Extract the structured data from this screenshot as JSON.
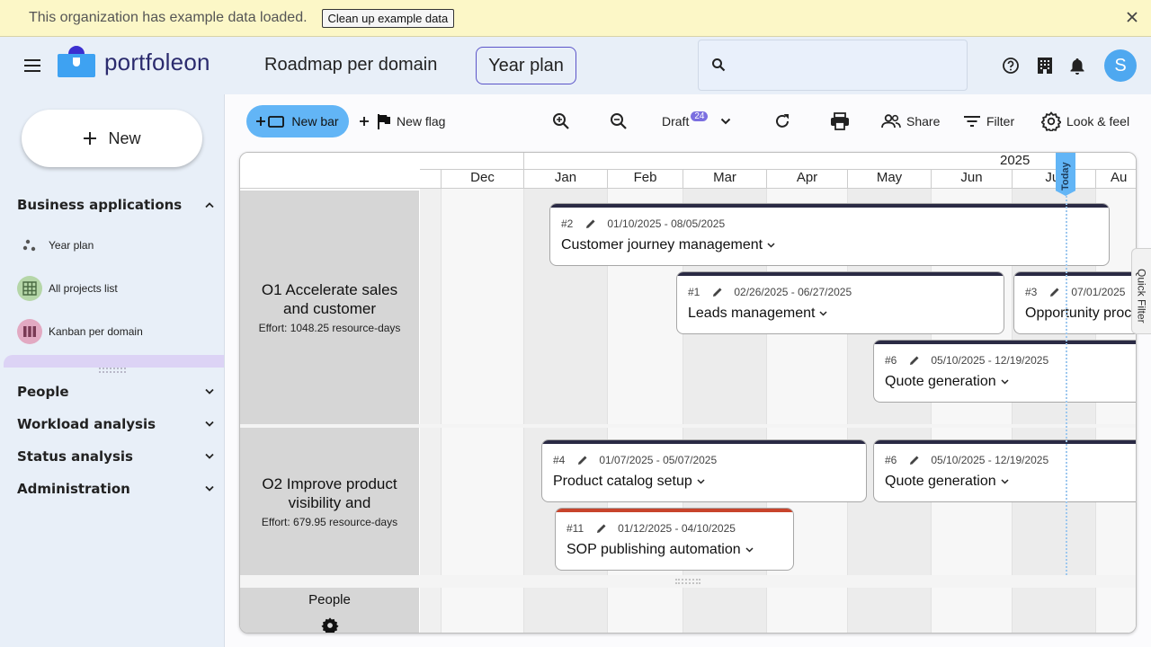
{
  "banner": {
    "text": "This organization has example data loaded.",
    "button_label": "Clean up example data"
  },
  "header": {
    "logo_text": "portfoleon",
    "page_title": "Roadmap per domain",
    "view_chip": "Year plan",
    "search_placeholder": "",
    "avatar_letter": "S"
  },
  "sidebar": {
    "new_label": "New",
    "sections": [
      {
        "label": "Business applications",
        "expanded": true
      },
      {
        "label": "People",
        "expanded": false
      },
      {
        "label": "Workload analysis",
        "expanded": false
      },
      {
        "label": "Status analysis",
        "expanded": false
      },
      {
        "label": "Administration",
        "expanded": false
      }
    ],
    "items": [
      {
        "label": "Year plan",
        "icon": "scatter-icon"
      },
      {
        "label": "All projects list",
        "icon": "grid-icon"
      },
      {
        "label": "Kanban per domain",
        "icon": "kanban-icon"
      }
    ]
  },
  "toolbar": {
    "new_bar": "New bar",
    "new_flag": "New flag",
    "draft_label": "Draft",
    "draft_count": "24",
    "share": "Share",
    "filter": "Filter",
    "look_feel": "Look & feel"
  },
  "timeline": {
    "year": "2025",
    "months": [
      "Dec",
      "Jan",
      "Feb",
      "Mar",
      "Apr",
      "May",
      "Jun",
      "Jul",
      "Au"
    ],
    "today_label": "Today"
  },
  "lanes": [
    {
      "title": "O1 Accelerate sales and customer",
      "effort": "Effort: 1048.25  resource-days"
    },
    {
      "title": "O2 Improve product visibility and",
      "effort": "Effort: 679.95  resource-days"
    },
    {
      "title": "People",
      "effort": ""
    }
  ],
  "bars": [
    {
      "id": "#2",
      "dates": "01/10/2025 - 08/05/2025",
      "title": "Customer journey management",
      "stripe": "#2a2a44"
    },
    {
      "id": "#1",
      "dates": "02/26/2025 - 06/27/2025",
      "title": "Leads management",
      "stripe": "#2a2a44"
    },
    {
      "id": "#3",
      "dates": "07/01/2025",
      "title": "Opportunity proc",
      "stripe": "#2a2a44"
    },
    {
      "id": "#6",
      "dates": "05/10/2025 - 12/19/2025",
      "title": "Quote generation",
      "stripe": "#2a2a44"
    },
    {
      "id": "#4",
      "dates": "01/07/2025 - 05/07/2025",
      "title": "Product catalog setup",
      "stripe": "#2a2a44"
    },
    {
      "id": "#6",
      "dates": "05/10/2025 - 12/19/2025",
      "title": "Quote generation",
      "stripe": "#2a2a44"
    },
    {
      "id": "#11",
      "dates": "01/12/2025 - 04/10/2025",
      "title": "SOP publishing automation",
      "stripe": "#c8442c"
    }
  ],
  "quick_filter": "Quick Filter",
  "colors": {
    "accent": "#62b5f6",
    "brand": "#2b2b6e",
    "banner": "#fcf7c7",
    "lane_label_bg": "#d6d6d6"
  }
}
